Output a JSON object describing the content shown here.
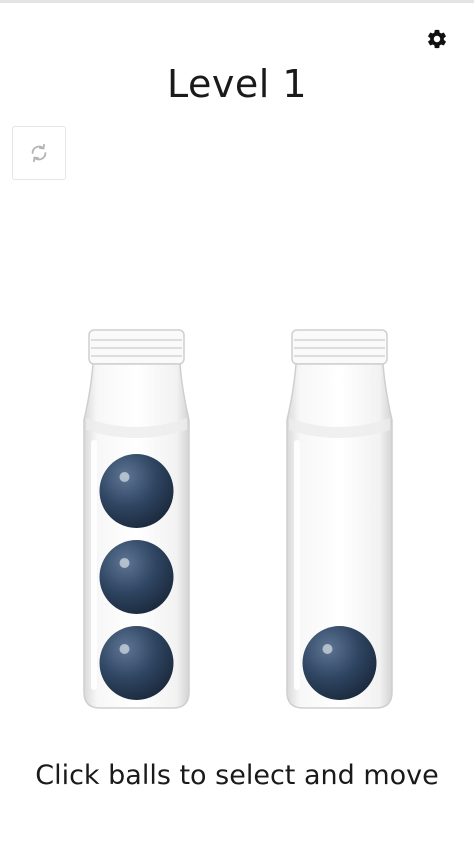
{
  "header": {
    "title": "Level 1",
    "settings_icon": "gear-icon",
    "restart_icon": "refresh-icon"
  },
  "board": {
    "ball_color": "#2f4562",
    "tubes": [
      {
        "balls": 3
      },
      {
        "balls": 1
      }
    ]
  },
  "footer": {
    "instructions": "Click balls to select and move"
  }
}
